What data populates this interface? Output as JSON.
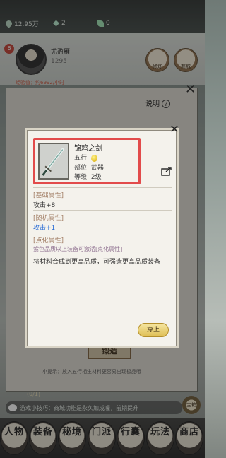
{
  "resources": {
    "gold": "12.95万",
    "jade": "2",
    "leaf": "0"
  },
  "player": {
    "level": "6",
    "name": "尤盈雁",
    "cultivation": "1295",
    "income": "经验值：约6992/小时"
  },
  "header_buttons": [
    "修炼",
    "商城"
  ],
  "background_panel": {
    "explain_label": "说明",
    "help_symbol": "?",
    "forge_label": "锻造",
    "tip": "小提示：放入五行相生材料更容易出现极品哦"
  },
  "item_modal": {
    "name": "锦鸡之剑",
    "element_label": "五行:",
    "slot_label": "部位:",
    "slot_value": "武器",
    "level_label": "等级:",
    "level_value": "2级",
    "base_title": "[基础属性]",
    "base_attr": "攻击+8",
    "random_title": "[随机属性]",
    "random_attr": "攻击+1",
    "enchant_title": "[点化属性]",
    "enchant_note": "紫色品质以上装备可激活[点化属性]",
    "forge_note": "将材料合成到更高品质，可强造更高品质装备",
    "wear_label": "穿上",
    "close_symbol": "✕"
  },
  "bottom": {
    "quest_progress": "(0/1)",
    "game_tip": "游戏小技巧：商城功能是永久加成喔，前期提升",
    "treasure_label": "宝箱"
  },
  "nav": [
    "人物",
    "装备",
    "秘境",
    "门派",
    "行囊",
    "玩法",
    "商店"
  ],
  "colors": {
    "highlight_border": "#e24b4b",
    "random_attr": "#2d6fd6",
    "enchant_note": "#8d6e8e",
    "section_title": "#a17d64"
  }
}
